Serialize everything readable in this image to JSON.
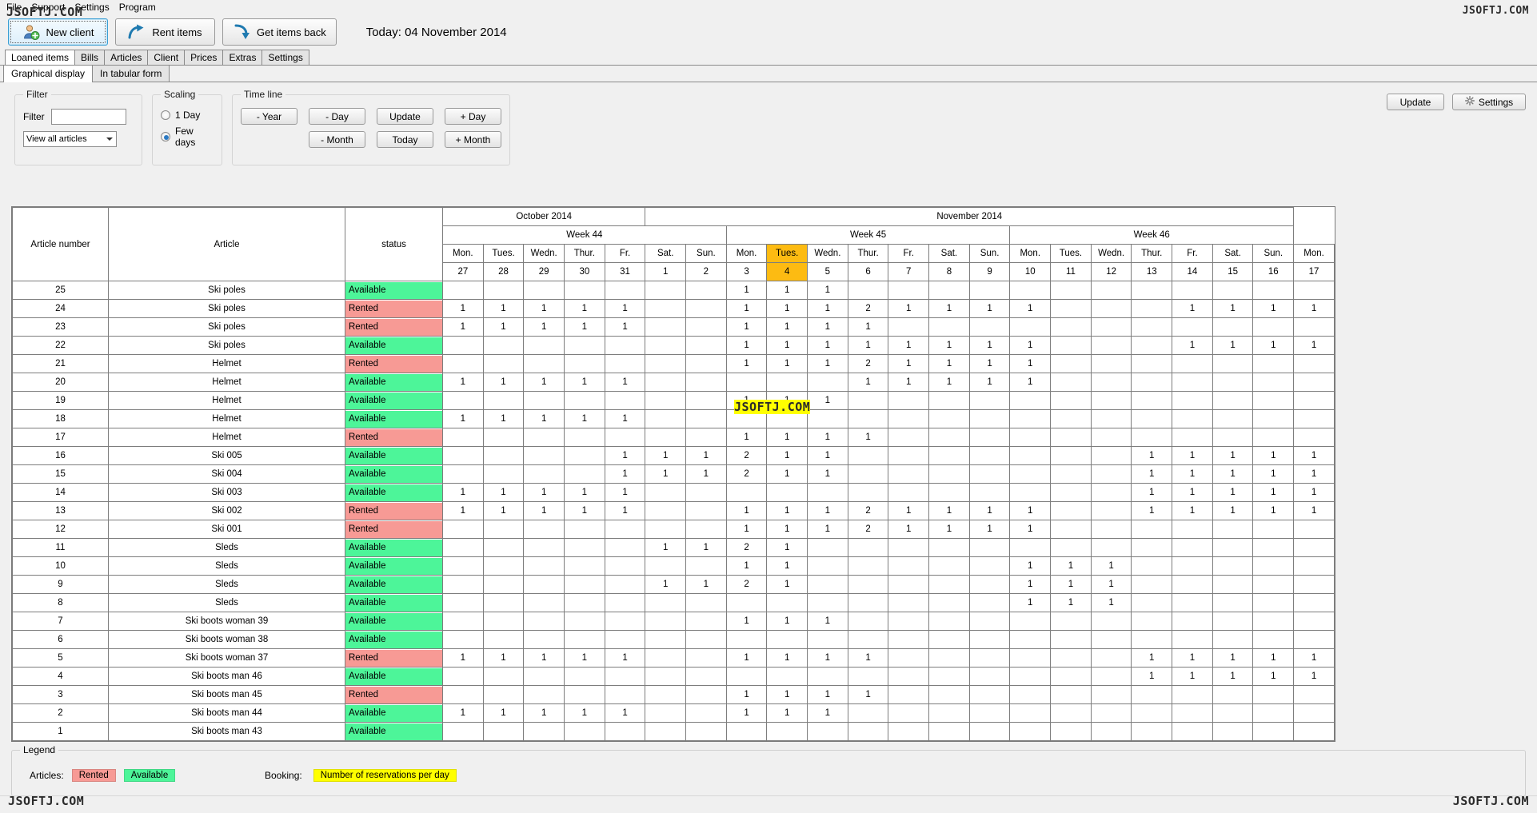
{
  "watermark": "JSOFTJ.COM",
  "menu": {
    "items": [
      {
        "label": "File"
      },
      {
        "label": "Support"
      },
      {
        "label": "Settings"
      },
      {
        "label": "Program"
      }
    ]
  },
  "toolbar": {
    "new_client": "New client",
    "rent_items": "Rent items",
    "get_items_back": "Get items back",
    "today_label": "Today: 04 November 2014"
  },
  "tabs": [
    {
      "label": "Loaned items",
      "active": true
    },
    {
      "label": "Bills",
      "active": false
    },
    {
      "label": "Articles",
      "active": false
    },
    {
      "label": "Client",
      "active": false
    },
    {
      "label": "Prices",
      "active": false
    },
    {
      "label": "Extras",
      "active": false
    },
    {
      "label": "Settings",
      "active": false
    }
  ],
  "subtabs": [
    {
      "label": "Graphical display",
      "active": true
    },
    {
      "label": "In tabular form",
      "active": false
    }
  ],
  "filter": {
    "group_title": "Filter",
    "label": "Filter",
    "value": "",
    "placeholder": "",
    "select_value": "View all articles"
  },
  "scaling": {
    "group_title": "Scaling",
    "options": [
      {
        "label": "1 Day",
        "selected": false
      },
      {
        "label": "Few days",
        "selected": true
      }
    ]
  },
  "timeline": {
    "group_title": "Time line",
    "buttons": [
      "- Year",
      "- Day",
      "Update",
      "+ Day",
      "- Month",
      "Today",
      "+ Month"
    ]
  },
  "actions": {
    "update": "Update",
    "settings": "Settings"
  },
  "grid": {
    "headers": {
      "article_number": "Article number",
      "article": "Article",
      "status": "status"
    },
    "months": [
      {
        "label": "October 2014",
        "span": 5
      },
      {
        "label": "November 2014",
        "span": 16
      }
    ],
    "weeks": [
      {
        "label": "Week 44",
        "span": 7
      },
      {
        "label": "Week 45",
        "span": 7
      },
      {
        "label": "Week 46",
        "span": 7
      }
    ],
    "days": [
      "Mon.",
      "Tues.",
      "Wedn.",
      "Thur.",
      "Fr.",
      "Sat.",
      "Sun.",
      "Mon.",
      "Tues.",
      "Wedn.",
      "Thur.",
      "Fr.",
      "Sat.",
      "Sun.",
      "Mon.",
      "Tues.",
      "Wedn.",
      "Thur.",
      "Fr.",
      "Sat.",
      "Sun."
    ],
    "dates": [
      "27",
      "28",
      "29",
      "30",
      "31",
      "1",
      "2",
      "3",
      "4",
      "5",
      "6",
      "7",
      "8",
      "9",
      "10",
      "11",
      "12",
      "13",
      "14",
      "15",
      "16"
    ],
    "days_tail": [
      "Mon."
    ],
    "dates_tail": [
      "17"
    ],
    "today_index": 8,
    "rows": [
      {
        "num": "25",
        "article": "Ski poles",
        "status": "Available",
        "cells": [
          "",
          "",
          "",
          "",
          "",
          "",
          "",
          "1",
          "1",
          "1",
          "",
          "",
          "",
          "",
          "",
          "",
          "",
          "",
          "",
          "",
          ""
        ],
        "tail": ""
      },
      {
        "num": "24",
        "article": "Ski poles",
        "status": "Rented",
        "cells": [
          "1",
          "1",
          "1",
          "1",
          "1",
          "",
          "",
          "1",
          "1",
          "1",
          "2",
          "1",
          "1",
          "1",
          "1",
          "",
          "",
          "",
          "1",
          "1",
          "1"
        ],
        "tail": "1"
      },
      {
        "num": "23",
        "article": "Ski poles",
        "status": "Rented",
        "cells": [
          "1",
          "1",
          "1",
          "1",
          "1",
          "",
          "",
          "1",
          "1",
          "1",
          "1",
          "",
          "",
          "",
          "",
          "",
          "",
          "",
          "",
          "",
          ""
        ],
        "tail": ""
      },
      {
        "num": "22",
        "article": "Ski poles",
        "status": "Available",
        "cells": [
          "",
          "",
          "",
          "",
          "",
          "",
          "",
          "1",
          "1",
          "1",
          "1",
          "1",
          "1",
          "1",
          "1",
          "",
          "",
          "",
          "1",
          "1",
          "1"
        ],
        "tail": "1"
      },
      {
        "num": "21",
        "article": "Helmet",
        "status": "Rented",
        "cells": [
          "",
          "",
          "",
          "",
          "",
          "",
          "",
          "1",
          "1",
          "1",
          "2",
          "1",
          "1",
          "1",
          "1",
          "",
          "",
          "",
          "",
          "",
          ""
        ],
        "tail": ""
      },
      {
        "num": "20",
        "article": "Helmet",
        "status": "Available",
        "cells": [
          "1",
          "1",
          "1",
          "1",
          "1",
          "",
          "",
          "",
          "",
          "",
          "1",
          "1",
          "1",
          "1",
          "1",
          "",
          "",
          "",
          "",
          "",
          ""
        ],
        "tail": ""
      },
      {
        "num": "19",
        "article": "Helmet",
        "status": "Available",
        "cells": [
          "",
          "",
          "",
          "",
          "",
          "",
          "",
          "1",
          "1",
          "1",
          "",
          "",
          "",
          "",
          "",
          "",
          "",
          "",
          "",
          "",
          ""
        ],
        "tail": ""
      },
      {
        "num": "18",
        "article": "Helmet",
        "status": "Available",
        "cells": [
          "1",
          "1",
          "1",
          "1",
          "1",
          "",
          "",
          "",
          "",
          "",
          "",
          "",
          "",
          "",
          "",
          "",
          "",
          "",
          "",
          "",
          ""
        ],
        "tail": ""
      },
      {
        "num": "17",
        "article": "Helmet",
        "status": "Rented",
        "cells": [
          "",
          "",
          "",
          "",
          "",
          "",
          "",
          "1",
          "1",
          "1",
          "1",
          "",
          "",
          "",
          "",
          "",
          "",
          "",
          "",
          "",
          ""
        ],
        "tail": ""
      },
      {
        "num": "16",
        "article": "Ski 005",
        "status": "Available",
        "cells": [
          "",
          "",
          "",
          "",
          "1",
          "1",
          "1",
          "2",
          "1",
          "1",
          "",
          "",
          "",
          "",
          "",
          "",
          "",
          "1",
          "1",
          "1",
          "1"
        ],
        "tail": "1"
      },
      {
        "num": "15",
        "article": "Ski 004",
        "status": "Available",
        "cells": [
          "",
          "",
          "",
          "",
          "1",
          "1",
          "1",
          "2",
          "1",
          "1",
          "",
          "",
          "",
          "",
          "",
          "",
          "",
          "1",
          "1",
          "1",
          "1"
        ],
        "tail": "1"
      },
      {
        "num": "14",
        "article": "Ski 003",
        "status": "Available",
        "cells": [
          "1",
          "1",
          "1",
          "1",
          "1",
          "",
          "",
          "",
          "",
          "",
          "",
          "",
          "",
          "",
          "",
          "",
          "",
          "1",
          "1",
          "1",
          "1"
        ],
        "tail": "1"
      },
      {
        "num": "13",
        "article": "Ski 002",
        "status": "Rented",
        "cells": [
          "1",
          "1",
          "1",
          "1",
          "1",
          "",
          "",
          "1",
          "1",
          "1",
          "2",
          "1",
          "1",
          "1",
          "1",
          "",
          "",
          "1",
          "1",
          "1",
          "1"
        ],
        "tail": "1"
      },
      {
        "num": "12",
        "article": "Ski 001",
        "status": "Rented",
        "cells": [
          "",
          "",
          "",
          "",
          "",
          "",
          "",
          "1",
          "1",
          "1",
          "2",
          "1",
          "1",
          "1",
          "1",
          "",
          "",
          "",
          "",
          "",
          ""
        ],
        "tail": ""
      },
      {
        "num": "11",
        "article": "Sleds",
        "status": "Available",
        "cells": [
          "",
          "",
          "",
          "",
          "",
          "1",
          "1",
          "2",
          "1",
          "",
          "",
          "",
          "",
          "",
          "",
          "",
          "",
          "",
          "",
          "",
          ""
        ],
        "tail": ""
      },
      {
        "num": "10",
        "article": "Sleds",
        "status": "Available",
        "cells": [
          "",
          "",
          "",
          "",
          "",
          "",
          "",
          "1",
          "1",
          "",
          "",
          "",
          "",
          "",
          "1",
          "1",
          "1",
          "",
          "",
          "",
          ""
        ],
        "tail": ""
      },
      {
        "num": "9",
        "article": "Sleds",
        "status": "Available",
        "cells": [
          "",
          "",
          "",
          "",
          "",
          "1",
          "1",
          "2",
          "1",
          "",
          "",
          "",
          "",
          "",
          "1",
          "1",
          "1",
          "",
          "",
          "",
          ""
        ],
        "tail": ""
      },
      {
        "num": "8",
        "article": "Sleds",
        "status": "Available",
        "cells": [
          "",
          "",
          "",
          "",
          "",
          "",
          "",
          "",
          "",
          "",
          "",
          "",
          "",
          "",
          "1",
          "1",
          "1",
          "",
          "",
          "",
          ""
        ],
        "tail": ""
      },
      {
        "num": "7",
        "article": "Ski boots woman 39",
        "status": "Available",
        "cells": [
          "",
          "",
          "",
          "",
          "",
          "",
          "",
          "1",
          "1",
          "1",
          "",
          "",
          "",
          "",
          "",
          "",
          "",
          "",
          "",
          "",
          ""
        ],
        "tail": ""
      },
      {
        "num": "6",
        "article": "Ski boots woman 38",
        "status": "Available",
        "cells": [
          "",
          "",
          "",
          "",
          "",
          "",
          "",
          "",
          "",
          "",
          "",
          "",
          "",
          "",
          "",
          "",
          "",
          "",
          "",
          "",
          ""
        ],
        "tail": ""
      },
      {
        "num": "5",
        "article": "Ski boots woman 37",
        "status": "Rented",
        "cells": [
          "1",
          "1",
          "1",
          "1",
          "1",
          "",
          "",
          "1",
          "1",
          "1",
          "1",
          "",
          "",
          "",
          "",
          "",
          "",
          "1",
          "1",
          "1",
          "1"
        ],
        "tail": "1"
      },
      {
        "num": "4",
        "article": "Ski boots man 46",
        "status": "Available",
        "cells": [
          "",
          "",
          "",
          "",
          "",
          "",
          "",
          "",
          "",
          "",
          "",
          "",
          "",
          "",
          "",
          "",
          "",
          "1",
          "1",
          "1",
          "1"
        ],
        "tail": "1"
      },
      {
        "num": "3",
        "article": "Ski boots man 45",
        "status": "Rented",
        "cells": [
          "",
          "",
          "",
          "",
          "",
          "",
          "",
          "1",
          "1",
          "1",
          "1",
          "",
          "",
          "",
          "",
          "",
          "",
          "",
          "",
          "",
          ""
        ],
        "tail": ""
      },
      {
        "num": "2",
        "article": "Ski boots man 44",
        "status": "Available",
        "cells": [
          "1",
          "1",
          "1",
          "1",
          "1",
          "",
          "",
          "1",
          "1",
          "1",
          "",
          "",
          "",
          "",
          "",
          "",
          "",
          "",
          "",
          "",
          ""
        ],
        "tail": ""
      },
      {
        "num": "1",
        "article": "Ski boots man 43",
        "status": "Available",
        "cells": [
          "",
          "",
          "",
          "",
          "",
          "",
          "",
          "",
          "",
          "",
          "",
          "",
          "",
          "",
          "",
          "",
          "",
          "",
          "",
          "",
          ""
        ],
        "tail": ""
      }
    ]
  },
  "legend": {
    "title": "Legend",
    "articles_label": "Articles:",
    "rented": "Rented",
    "available": "Available",
    "booking_label": "Booking:",
    "booking_text": "Number of reservations per day"
  },
  "colors": {
    "available": "#4df599",
    "rented": "#f79a95",
    "booking": "#ffff00",
    "today": "#fdbb12"
  }
}
